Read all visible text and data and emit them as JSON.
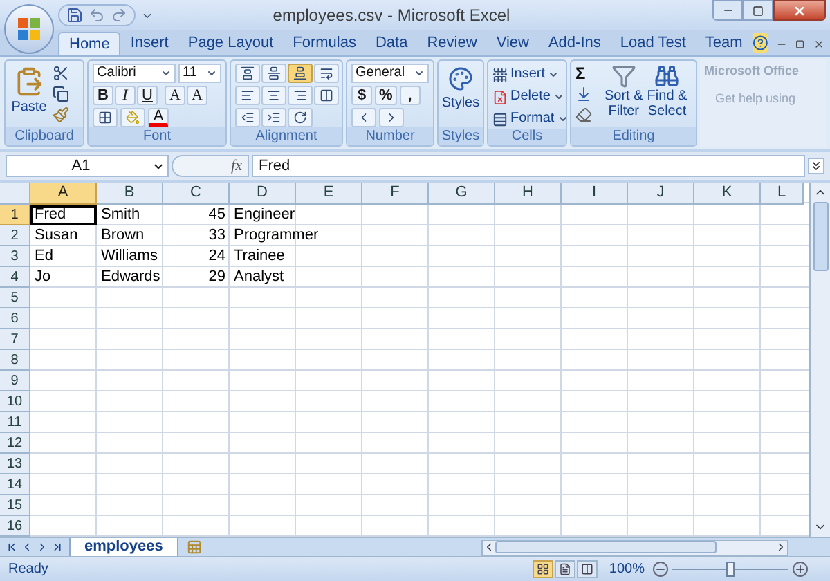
{
  "window": {
    "title": "employees.csv - Microsoft Excel"
  },
  "tabs": [
    {
      "label": "Home",
      "selected": true
    },
    {
      "label": "Insert",
      "selected": false
    },
    {
      "label": "Page Layout",
      "selected": false
    },
    {
      "label": "Formulas",
      "selected": false
    },
    {
      "label": "Data",
      "selected": false
    },
    {
      "label": "Review",
      "selected": false
    },
    {
      "label": "View",
      "selected": false
    },
    {
      "label": "Add-Ins",
      "selected": false
    },
    {
      "label": "Load Test",
      "selected": false
    },
    {
      "label": "Team",
      "selected": false
    }
  ],
  "clipboard": {
    "label": "Clipboard",
    "paste": "Paste"
  },
  "font": {
    "label": "Font",
    "name": "Calibri",
    "size": "11",
    "bold": "B",
    "italic": "I",
    "underline": "U",
    "grow": "A",
    "shrink": "A",
    "font_color_letter": "A"
  },
  "alignment": {
    "label": "Alignment"
  },
  "number": {
    "label": "Number",
    "format": "General",
    "currency": "$",
    "percent": "%",
    "comma": ","
  },
  "styles": {
    "label": "Styles",
    "button": "Styles"
  },
  "cells": {
    "label": "Cells",
    "insert": "Insert",
    "delete": "Delete",
    "format": "Format"
  },
  "editing": {
    "label": "Editing",
    "sum": "Σ",
    "sort": [
      "Sort &",
      "Filter"
    ],
    "find": [
      "Find &",
      "Select"
    ]
  },
  "help_tooltip": {
    "title": "Microsoft Office",
    "body": "Get help using"
  },
  "formula_bar": {
    "name_box": "A1",
    "function_label": "fx",
    "value": "Fred"
  },
  "columns": [
    {
      "label": "A",
      "selected": true,
      "kind": "text"
    },
    {
      "label": "B",
      "selected": false,
      "kind": "text"
    },
    {
      "label": "C",
      "selected": false,
      "kind": "number"
    },
    {
      "label": "D",
      "selected": false,
      "kind": "text"
    },
    {
      "label": "E",
      "selected": false,
      "kind": "text"
    },
    {
      "label": "F",
      "selected": false,
      "kind": "text"
    },
    {
      "label": "G",
      "selected": false,
      "kind": "text"
    },
    {
      "label": "H",
      "selected": false,
      "kind": "text"
    },
    {
      "label": "I",
      "selected": false,
      "kind": "text"
    },
    {
      "label": "J",
      "selected": false,
      "kind": "text"
    },
    {
      "label": "K",
      "selected": false,
      "kind": "text"
    },
    {
      "label": "L",
      "selected": false,
      "kind": "text"
    }
  ],
  "rows": [
    {
      "label": "1",
      "selected": true,
      "cells": [
        "Fred",
        "Smith",
        "45",
        "Engineer"
      ]
    },
    {
      "label": "2",
      "selected": false,
      "cells": [
        "Susan",
        "Brown",
        "33",
        "Programmer"
      ]
    },
    {
      "label": "3",
      "selected": false,
      "cells": [
        "Ed",
        "Williams",
        "24",
        "Trainee"
      ]
    },
    {
      "label": "4",
      "selected": false,
      "cells": [
        "Jo",
        "Edwards",
        "29",
        "Analyst"
      ]
    },
    {
      "label": "5",
      "selected": false,
      "cells": []
    },
    {
      "label": "6",
      "selected": false,
      "cells": []
    },
    {
      "label": "7",
      "selected": false,
      "cells": []
    },
    {
      "label": "8",
      "selected": false,
      "cells": []
    },
    {
      "label": "9",
      "selected": false,
      "cells": []
    },
    {
      "label": "10",
      "selected": false,
      "cells": []
    },
    {
      "label": "11",
      "selected": false,
      "cells": []
    },
    {
      "label": "12",
      "selected": false,
      "cells": []
    },
    {
      "label": "13",
      "selected": false,
      "cells": []
    },
    {
      "label": "14",
      "selected": false,
      "cells": []
    },
    {
      "label": "15",
      "selected": false,
      "cells": []
    },
    {
      "label": "16",
      "selected": false,
      "cells": []
    }
  ],
  "sheet_tabs": [
    {
      "label": "employees",
      "selected": true
    }
  ],
  "status_bar": {
    "text": "Ready",
    "views": [
      {
        "kind": "normal",
        "selected": true
      },
      {
        "kind": "page_layout",
        "selected": false
      },
      {
        "kind": "page_break",
        "selected": false
      }
    ],
    "zoom": "100%",
    "zoom_slider": {
      "level": 0.5
    }
  }
}
